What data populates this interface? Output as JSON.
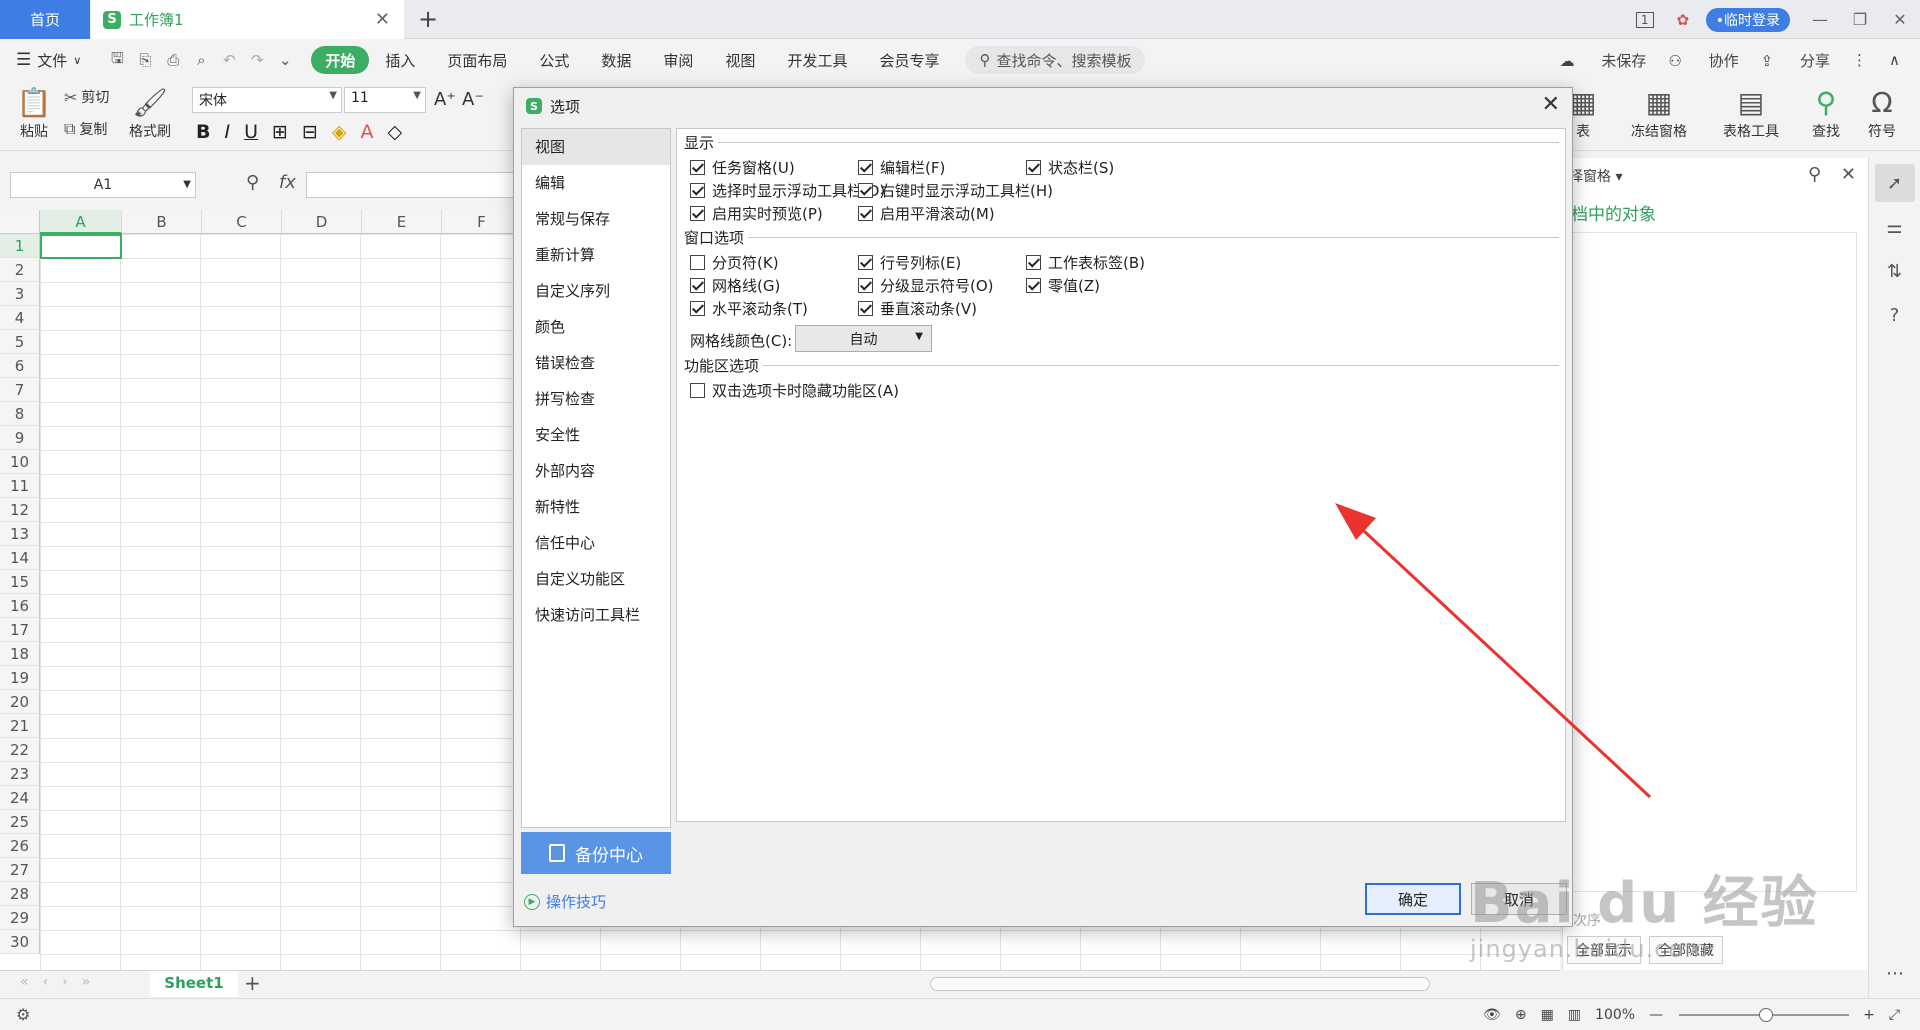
{
  "tabbar": {
    "home_tab": "首页",
    "doc_tab": "工作簿1",
    "logo_letter": "S",
    "page_indicator": "1",
    "login_button": "•临时登录"
  },
  "menubar": {
    "file": "文件",
    "tabs": [
      "开始",
      "插入",
      "页面布局",
      "公式",
      "数据",
      "审阅",
      "视图",
      "开发工具",
      "会员专享"
    ],
    "search_placeholder": "查找命令、搜索模板",
    "unsaved": "未保存",
    "collaborate": "协作",
    "share": "分享"
  },
  "ribbon": {
    "paste": "粘贴",
    "cut": "剪切",
    "copy": "复制",
    "format_painter": "格式刷",
    "font_name": "宋体",
    "font_size": "11",
    "right_partial": "表",
    "freeze_panes": "冻结窗格",
    "table_tools": "表格工具",
    "find": "查找",
    "symbol": "符号"
  },
  "formula_bar": {
    "name_box": "A1",
    "fx": "fx"
  },
  "grid": {
    "columns": [
      "A",
      "B",
      "C",
      "D",
      "E",
      "F"
    ],
    "rows": [
      "1",
      "2",
      "3",
      "4",
      "5",
      "6",
      "7",
      "8",
      "9",
      "10",
      "11",
      "12",
      "13",
      "14",
      "15",
      "16",
      "17",
      "18",
      "19",
      "20",
      "21",
      "22",
      "23",
      "24",
      "25",
      "26",
      "27",
      "28",
      "29",
      "30"
    ]
  },
  "sheets": {
    "active": "Sheet1",
    "zoom": "100%"
  },
  "task_pane": {
    "header": "择窗格",
    "title": "档中的对象",
    "show_all": "全部显示",
    "hide_all": "全部隐藏",
    "order_partial": "次序"
  },
  "dialog": {
    "title": "选项",
    "nav_items": [
      "视图",
      "编辑",
      "常规与保存",
      "重新计算",
      "自定义序列",
      "颜色",
      "错误检查",
      "拼写检查",
      "安全性",
      "外部内容",
      "新特性",
      "信任中心",
      "自定义功能区",
      "快速访问工具栏"
    ],
    "active_nav": "视图",
    "backup_center": "备份中心",
    "tips": "操作技巧",
    "sections": {
      "display": {
        "title": "显示",
        "options": [
          {
            "label": "任务窗格(U)",
            "checked": true
          },
          {
            "label": "编辑栏(F)",
            "checked": true
          },
          {
            "label": "状态栏(S)",
            "checked": true
          },
          {
            "label": "选择时显示浮动工具栏(D)",
            "checked": true
          },
          {
            "label": "右键时显示浮动工具栏(H)",
            "checked": true
          },
          {
            "label": "启用实时预览(P)",
            "checked": true
          },
          {
            "label": "启用平滑滚动(M)",
            "checked": true
          }
        ]
      },
      "window": {
        "title": "窗口选项",
        "options": [
          {
            "label": "分页符(K)",
            "checked": false
          },
          {
            "label": "行号列标(E)",
            "checked": true
          },
          {
            "label": "工作表标签(B)",
            "checked": true
          },
          {
            "label": "网格线(G)",
            "checked": true
          },
          {
            "label": "分级显示符号(O)",
            "checked": true
          },
          {
            "label": "零值(Z)",
            "checked": true
          },
          {
            "label": "水平滚动条(T)",
            "checked": true
          },
          {
            "label": "垂直滚动条(V)",
            "checked": true
          }
        ],
        "grid_color_label": "网格线颜色(C):",
        "grid_color_value": "自动"
      },
      "ribbon": {
        "title": "功能区选项",
        "options": [
          {
            "label": "双击选项卡时隐藏功能区(A)",
            "checked": false
          }
        ]
      }
    },
    "ok": "确定",
    "cancel": "取消"
  },
  "watermark": {
    "main": "Bai du 经验",
    "sub": "jingyan.baidu.com"
  },
  "colors": {
    "accent_green": "#3dad64",
    "accent_blue": "#3d7de4",
    "arrow_red": "#e8332f"
  }
}
